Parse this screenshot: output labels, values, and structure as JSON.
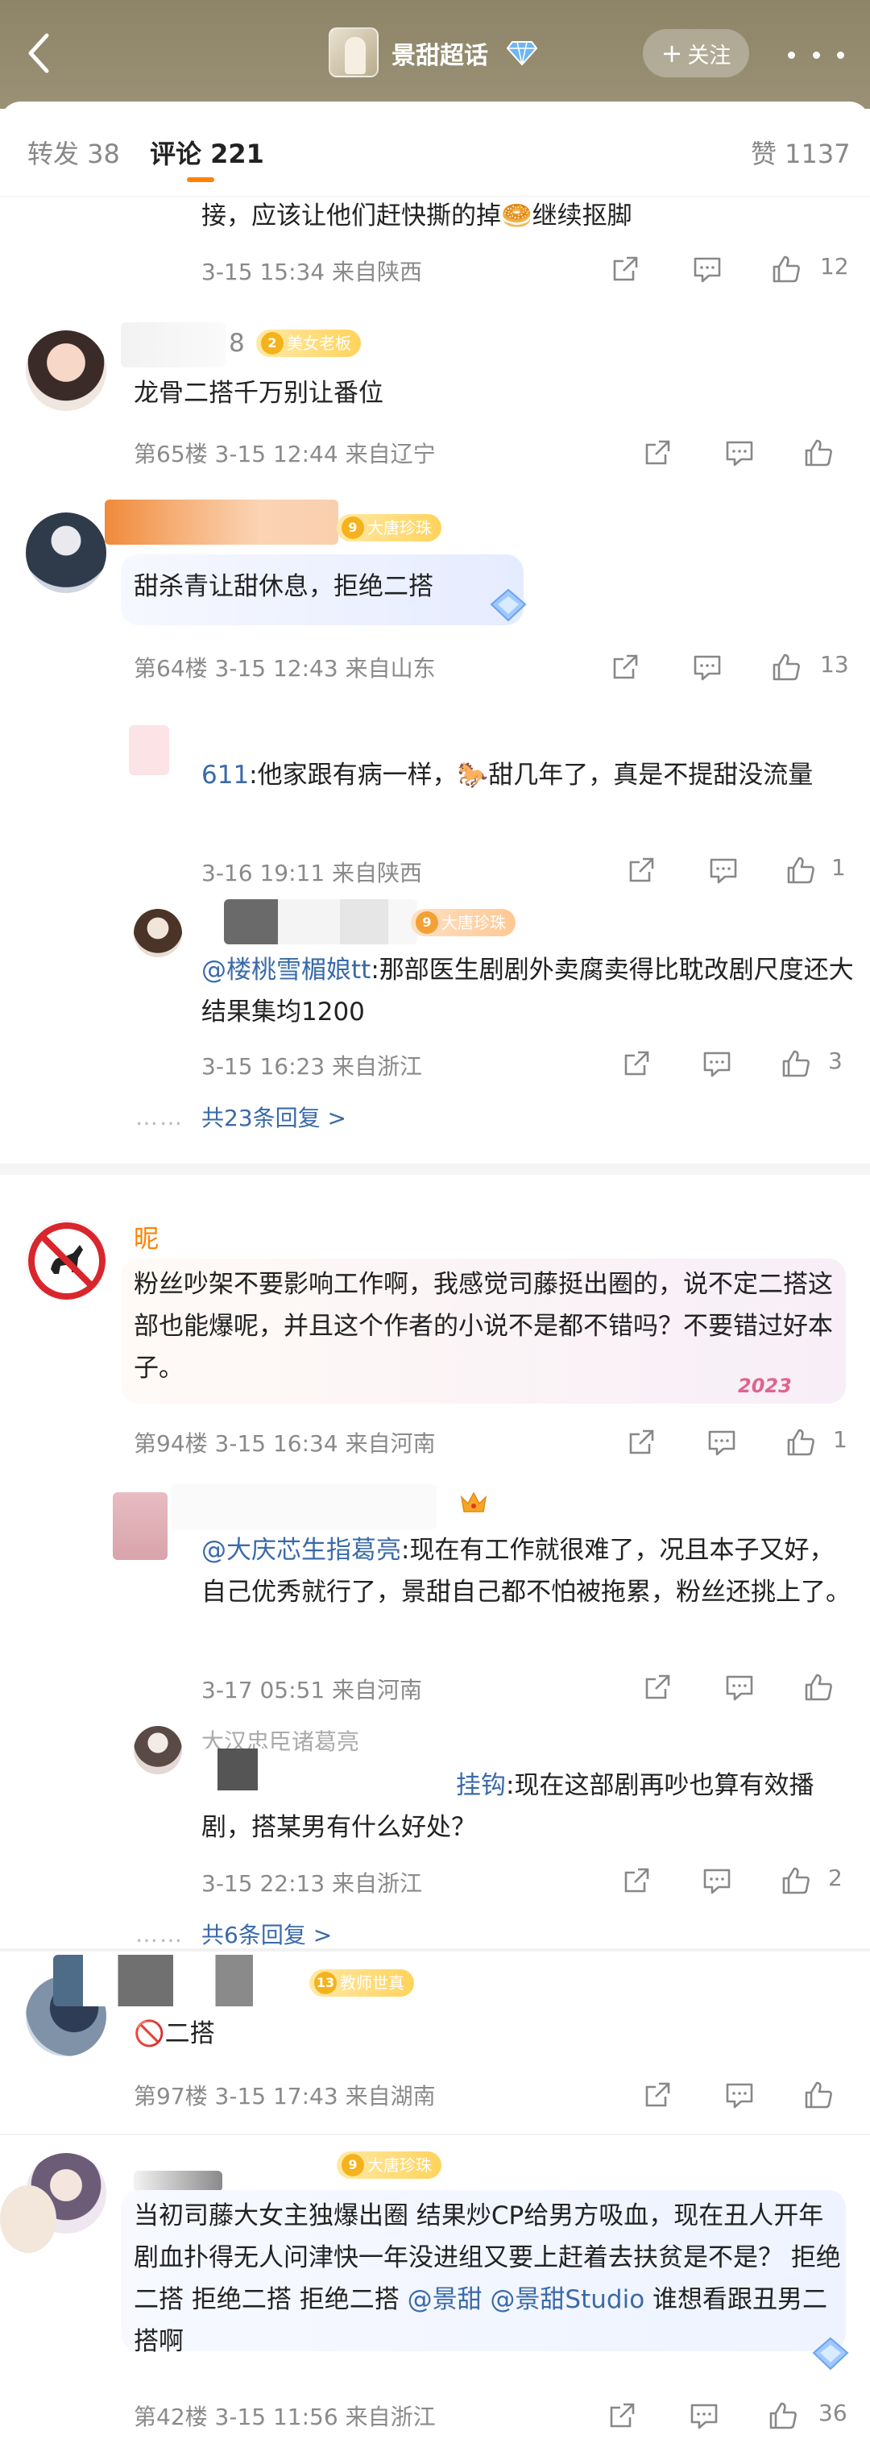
{
  "header": {
    "title": "景甜超话",
    "follow_label": "关注"
  },
  "tabs": {
    "repost": "转发 38",
    "comment": "评论 221",
    "like": "赞 1137"
  },
  "comments": [
    {
      "text": "接，应该让他们赶快撕的掉🥯继续抠脚",
      "meta": "3-15 15:34  来自陕西",
      "like": "12"
    },
    {
      "name_suffix": "8",
      "badge": "美女老板",
      "badge_lv": "2",
      "text": "龙骨二搭千万别让番位",
      "meta": "第65楼  3-15 12:44  来自辽宁",
      "like": ""
    },
    {
      "badge": "大唐珍珠",
      "badge_lv": "9",
      "text": "甜杀青让甜休息，拒绝二搭",
      "meta": "第64楼  3-15 12:43  来自山东",
      "like": "13",
      "replies": [
        {
          "name_partial": "611",
          "text": ":他家跟有病一样，🐎甜几年了，真是不提甜没流量",
          "meta": "3-16 19:11  来自陕西",
          "like": "1"
        },
        {
          "badge": "大唐珍珠",
          "badge_lv": "9",
          "name_partial": "@楼桃雪楣娘tt",
          "text": ":那部医生剧剧外卖腐卖得比耽改剧尺度还大结果集均1200",
          "meta": "3-15 16:23  来自浙江",
          "like": "3"
        }
      ],
      "more": "共23条回复 >"
    },
    {
      "name": "昵",
      "text": "粉丝吵架不要影响工作啊，我感觉司藤挺出圈的，说不定二搭这部也能爆呢，并且这个作者的小说不是都不错吗？不要错过好本子。",
      "meta": "第94楼  3-15 16:34  来自河南",
      "like": "1",
      "replies": [
        {
          "name_partial": "@大庆芯生指葛亮",
          "text": ":现在有工作就很难了，况且本子又好，自己优秀就行了，景甜自己都不怕被拖累，粉丝还挑上了。",
          "meta": "3-17 05:51  来自河南",
          "like": ""
        },
        {
          "name_partial": "大汉忠臣诸葛亮",
          "name_partial2": "挂钩",
          "text": ":现在这部剧再吵也算有效播剧，搭某男有什么好处？",
          "meta": "3-15 22:13  来自浙江",
          "like": "2"
        }
      ],
      "more": "共6条回复 >"
    },
    {
      "badge": "教师世真",
      "badge_lv": "13",
      "text": "🚫二搭",
      "meta": "第97楼  3-15 17:43  来自湖南",
      "like": ""
    },
    {
      "badge": "大唐珍珠",
      "badge_lv": "9",
      "text": "当初司藤大女主独爆出圈 结果炒CP给男方吸血，现在丑人开年剧血扑得无人问津快一年没进组又要上赶着去扶贫是不是？ 拒绝二搭 拒绝二搭 拒绝二搭 ",
      "at1": "@景甜",
      "at2": "@景甜Studio",
      "text_end": " 谁想看跟丑男二搭啊",
      "meta": "第42楼  3-15 11:56  来自浙江",
      "like": "36"
    }
  ],
  "decor": {
    "year_tag": "2023"
  },
  "colors": {
    "accent": "#ff8200",
    "link": "#3a6aa8",
    "meta": "#8a8a8a"
  },
  "icons": [
    "back-icon",
    "diamond-icon",
    "share-icon",
    "comment-icon",
    "like-icon",
    "more-icon"
  ]
}
